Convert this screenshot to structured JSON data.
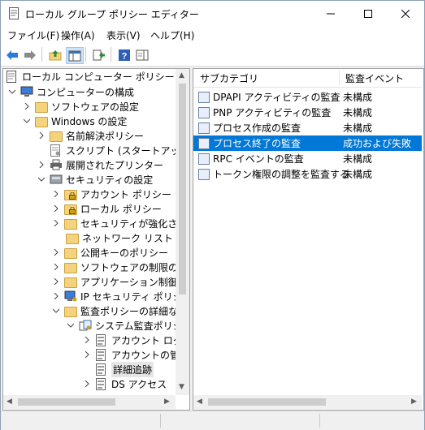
{
  "window": {
    "title": "ローカル グループ ポリシー エディター"
  },
  "menu": [
    {
      "label": "ファイル(F)"
    },
    {
      "label": "操作(A)"
    },
    {
      "label": "表示(V)"
    },
    {
      "label": "ヘルプ(H)"
    }
  ],
  "tree": {
    "items": [
      {
        "label": "ローカル コンピューター ポリシー",
        "icon": "policy-icon"
      },
      {
        "label": "コンピューターの構成",
        "icon": "computer-icon"
      },
      {
        "label": "ソフトウェアの設定",
        "icon": "folder-icon"
      },
      {
        "label": "Windows の設定",
        "icon": "folder-icon"
      },
      {
        "label": "名前解決ポリシー",
        "icon": "folder-icon"
      },
      {
        "label": "スクリプト (スタートアップ/シャ",
        "icon": "script-icon"
      },
      {
        "label": "展開されたプリンター",
        "icon": "printer-icon"
      },
      {
        "label": "セキュリティの設定",
        "icon": "security-icon"
      },
      {
        "label": "アカウント ポリシー",
        "icon": "folder-lock-icon"
      },
      {
        "label": "ローカル ポリシー",
        "icon": "folder-lock-icon"
      },
      {
        "label": "セキュリティが強化された",
        "icon": "folder-icon"
      },
      {
        "label": "ネットワーク リスト マネー",
        "icon": "folder-icon"
      },
      {
        "label": "公開キーのポリシー",
        "icon": "folder-icon"
      },
      {
        "label": "ソフトウェアの制限のポリ",
        "icon": "folder-icon"
      },
      {
        "label": "アプリケーション制御ポリ",
        "icon": "folder-icon"
      },
      {
        "label": "IP セキュリティ ポリシー (I",
        "icon": "ip-security-icon"
      },
      {
        "label": "監査ポリシーの詳細な構",
        "icon": "folder-icon"
      },
      {
        "label": "システム監査ポリシー -",
        "icon": "audit-icon"
      },
      {
        "label": "アカウント ログオ",
        "icon": "policy-doc-icon"
      },
      {
        "label": "アカウントの管理",
        "icon": "policy-doc-icon"
      },
      {
        "label": "詳細追跡",
        "icon": "policy-doc-icon"
      },
      {
        "label": "DS アクセス",
        "icon": "policy-doc-icon"
      }
    ]
  },
  "list": {
    "headers": {
      "subcategory": "サブカテゴリ",
      "audit_event": "監査イベント"
    },
    "rows": [
      {
        "name": "DPAPI アクティビティの監査",
        "value": "未構成"
      },
      {
        "name": "PNP アクティビティの監査",
        "value": "未構成"
      },
      {
        "name": "プロセス作成の監査",
        "value": "未構成"
      },
      {
        "name": "プロセス終了の監査",
        "value": "成功および失敗"
      },
      {
        "name": "RPC イベントの監査",
        "value": "未構成"
      },
      {
        "name": "トークン権限の調整を監査する",
        "value": "未構成"
      }
    ]
  },
  "colors": {
    "selection": "#0078d7",
    "folder": "#f5d37c"
  }
}
